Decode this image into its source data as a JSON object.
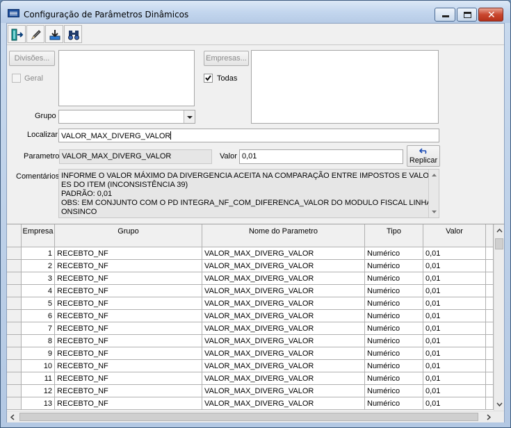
{
  "window": {
    "title": "Configuração de Parâmetros Dinâmicos"
  },
  "toolbar": {
    "icons": [
      "exit-icon",
      "pencil-icon",
      "download-icon",
      "binoculars-icon"
    ]
  },
  "filters": {
    "divisoes_button": "Divisões...",
    "geral_label": "Geral",
    "empresas_button": "Empresas...",
    "todas_label": "Todas",
    "todas_checked": true,
    "geral_checked": false,
    "grupo_label": "Grupo",
    "grupo_value": "",
    "localizar_label": "Localizar",
    "localizar_value": "VALOR_MAX_DIVERG_VALOR"
  },
  "detail": {
    "parametro_label": "Parametro",
    "parametro_value": "VALOR_MAX_DIVERG_VALOR",
    "valor_label": "Valor",
    "valor_value": "0,01",
    "replicar_button": "Replicar",
    "comentarios_label": "Comentários",
    "comentarios_lines": [
      "INFORME O VALOR MÁXIMO DA DIVERGENCIA ACEITA NA COMPARAÇÃO ENTRE IMPOSTOS E VALOR",
      "ES DO ITEM (INCONSISTÊNCIA 39)",
      "PADRÃO: 0,01",
      "OBS: EM CONJUNTO COM O PD INTEGRA_NF_COM_DIFERENCA_VALOR DO MODULO FISCAL LINHA C",
      "ONSINCO"
    ]
  },
  "table": {
    "headers": [
      "Empresa",
      "Grupo",
      "Nome do Parametro",
      "Tipo",
      "Valor"
    ],
    "rows": [
      [
        "1",
        "RECEBTO_NF",
        "VALOR_MAX_DIVERG_VALOR",
        "Numérico",
        "0,01"
      ],
      [
        "2",
        "RECEBTO_NF",
        "VALOR_MAX_DIVERG_VALOR",
        "Numérico",
        "0,01"
      ],
      [
        "3",
        "RECEBTO_NF",
        "VALOR_MAX_DIVERG_VALOR",
        "Numérico",
        "0,01"
      ],
      [
        "4",
        "RECEBTO_NF",
        "VALOR_MAX_DIVERG_VALOR",
        "Numérico",
        "0,01"
      ],
      [
        "5",
        "RECEBTO_NF",
        "VALOR_MAX_DIVERG_VALOR",
        "Numérico",
        "0,01"
      ],
      [
        "6",
        "RECEBTO_NF",
        "VALOR_MAX_DIVERG_VALOR",
        "Numérico",
        "0,01"
      ],
      [
        "7",
        "RECEBTO_NF",
        "VALOR_MAX_DIVERG_VALOR",
        "Numérico",
        "0,01"
      ],
      [
        "8",
        "RECEBTO_NF",
        "VALOR_MAX_DIVERG_VALOR",
        "Numérico",
        "0,01"
      ],
      [
        "9",
        "RECEBTO_NF",
        "VALOR_MAX_DIVERG_VALOR",
        "Numérico",
        "0,01"
      ],
      [
        "10",
        "RECEBTO_NF",
        "VALOR_MAX_DIVERG_VALOR",
        "Numérico",
        "0,01"
      ],
      [
        "11",
        "RECEBTO_NF",
        "VALOR_MAX_DIVERG_VALOR",
        "Numérico",
        "0,01"
      ],
      [
        "12",
        "RECEBTO_NF",
        "VALOR_MAX_DIVERG_VALOR",
        "Numérico",
        "0,01"
      ],
      [
        "13",
        "RECEBTO_NF",
        "VALOR_MAX_DIVERG_VALOR",
        "Numérico",
        "0,01"
      ]
    ]
  }
}
